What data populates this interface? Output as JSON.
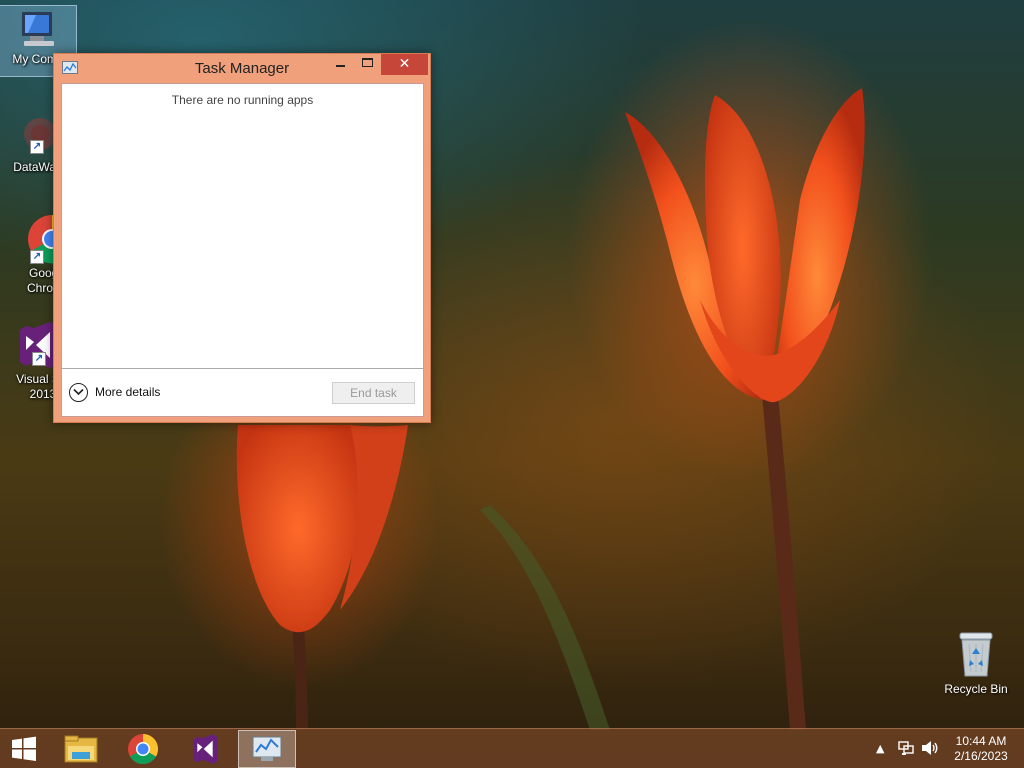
{
  "desktop": {
    "icons": [
      {
        "label": "My Comp",
        "icon": "computer-icon"
      },
      {
        "label": "DataWag",
        "icon": "app-icon"
      },
      {
        "label": "Googl\nChrom",
        "icon": "chrome-icon"
      },
      {
        "label": "Visual Stu\n2013",
        "icon": "visual-studio-icon"
      }
    ],
    "recycle_bin": {
      "label": "Recycle Bin",
      "icon": "recycle-bin-icon"
    }
  },
  "task_manager": {
    "title": "Task Manager",
    "empty_message": "There are no running apps",
    "more_details_label": "More details",
    "end_task_label": "End task",
    "end_task_enabled": false,
    "buttons": {
      "minimize": "minimize-icon",
      "maximize": "maximize-icon",
      "close": "close-icon"
    }
  },
  "taskbar": {
    "pinned": [
      {
        "name": "file-explorer",
        "icon": "folder-icon"
      },
      {
        "name": "chrome",
        "icon": "chrome-icon"
      },
      {
        "name": "visual-studio",
        "icon": "visual-studio-icon"
      },
      {
        "name": "task-manager",
        "icon": "task-manager-icon",
        "active": true
      }
    ],
    "clock": {
      "time": "10:44 AM",
      "date": "2/16/2023"
    },
    "tray_icons": [
      "show-hidden-icons-icon",
      "network-icon",
      "volume-icon"
    ]
  },
  "colors": {
    "window_frame": "#f0a07a",
    "close_button": "#c7463a",
    "taskbar": "#784628"
  }
}
